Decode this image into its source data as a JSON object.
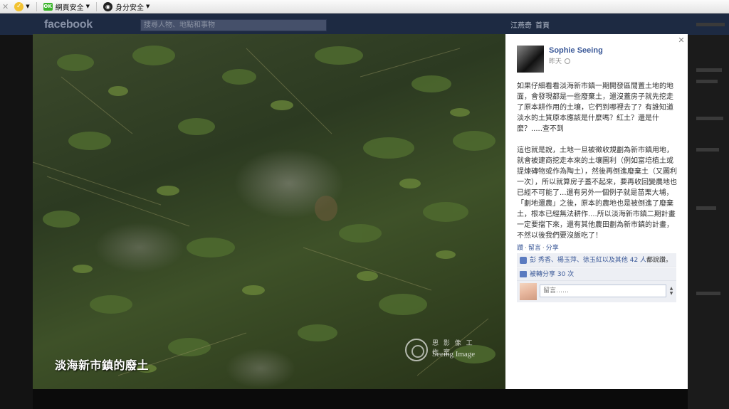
{
  "browser_toolbar": {
    "web_security_label": "網頁安全",
    "identity_security_label": "身分安全"
  },
  "facebook_bg": {
    "logo": "facebook",
    "search_placeholder": "搜尋人物、地點和事物",
    "user_name": "江燕奇",
    "home_label": "首頁"
  },
  "photo": {
    "caption": "淡海新市鎮的廢土",
    "watermark_cn": "思 影 像 工 作 室",
    "watermark_en": "Seeing Image"
  },
  "post": {
    "author": "Sophie Seeing",
    "timestamp": "昨天",
    "paragraphs": [
      "如果仔細看看淡海新市鎮一期開發區閒置土地的地面，會發現都是一些廢棄土，還沒蓋房子就先挖走了原本耕作用的土壤，它們到哪裡去了？有誰知道淡水的土質原本應該是什麼嗎？紅土？還是什麼？.....查不到",
      "這也就是說，土地一旦被徵收規劃為新市鎮用地，就會被建商挖走本來的土壤圖利（例如富培植土或提煉磚物或作為陶土），然後再倒進廢棄土（又圖利一次），所以就算房子蓋不起來，要再收回變農地也已經不可能了...還有另外一個例子就是苗栗大埔，「劃地還農」之後，原本的農地也是被倒進了廢棄土，根本已經無法耕作....所以淡海新市鎮二期計畫一定要擋下來，還有其他農田劃為新市鎮的計畫，不然以後我們要沒飯吃了！"
    ],
    "actions": {
      "like": "讚",
      "comment": "留言",
      "share": "分享"
    },
    "likes_text_link": "彭 秀香、楊玉萍、徐玉紅以及其他 42 人",
    "likes_text_suffix": "都說讚。",
    "shares_text": "被轉分享 30 次",
    "comment_placeholder": "留言……"
  },
  "colors": {
    "link": "#3b5998",
    "panel_bg": "#ffffff",
    "box_bg": "#edeff4"
  }
}
